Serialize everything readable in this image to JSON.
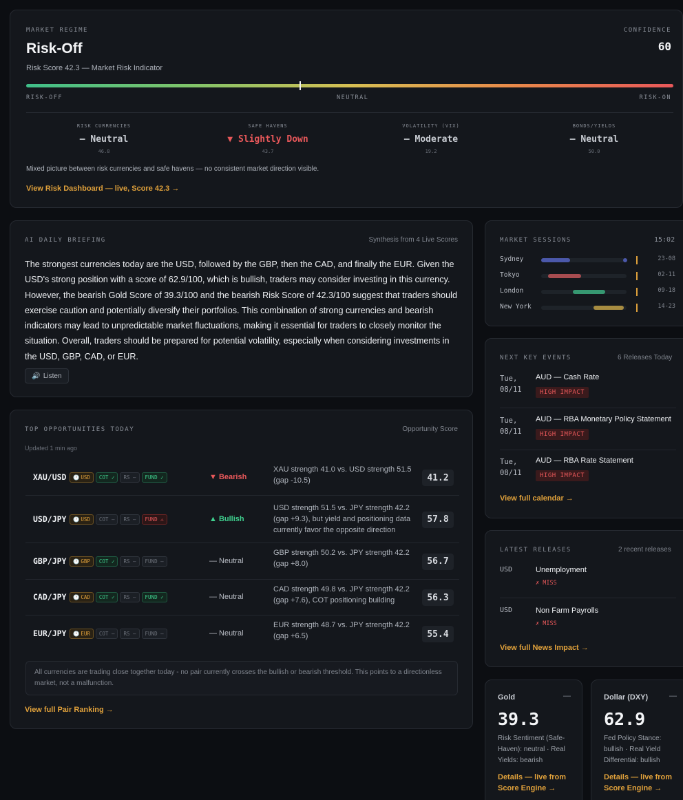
{
  "regime": {
    "label": "MARKET REGIME",
    "title": "Risk-Off",
    "subtitle": "Risk Score 42.3 — Market Risk Indicator",
    "confidence_label": "CONFIDENCE",
    "confidence_value": "60",
    "scale_left": "RISK-OFF",
    "scale_mid": "NEUTRAL",
    "scale_right": "RISK-ON",
    "score": 42.3,
    "indicators": [
      {
        "title": "RISK CURRENCIES",
        "value": "— Neutral",
        "num": "46.8"
      },
      {
        "title": "SAFE HAVENS",
        "value": "▼ Slightly Down",
        "num": "43.7"
      },
      {
        "title": "VOLATILITY (VIX)",
        "value": "— Moderate",
        "num": "19.2"
      },
      {
        "title": "BONDS/YIELDS",
        "value": "— Neutral",
        "num": "50.0"
      }
    ],
    "summary": "Mixed picture between risk currencies and safe havens — no consistent market direction visible.",
    "link": "View Risk Dashboard — live, Score 42.3 →"
  },
  "briefing": {
    "label": "AI DAILY BRIEFING",
    "meta": "Synthesis from 4 Live Scores",
    "text": "The strongest currencies today are the USD, followed by the GBP, then the CAD, and finally the EUR. Given the USD's strong position with a score of 62.9/100, which is bullish, traders may consider investing in this currency. However, the bearish Gold Score of 39.3/100 and the bearish Risk Score of 42.3/100 suggest that traders should exercise caution and potentially diversify their portfolios. This combination of strong currencies and bearish indicators may lead to unpredictable market fluctuations, making it essential for traders to closely monitor the situation. Overall, traders should be prepared for potential volatility, especially when considering investments in the USD, GBP, CAD, or EUR.",
    "listen": "Listen"
  },
  "opps": {
    "label": "TOP OPPORTUNITIES TODAY",
    "meta": "Opportunity Score",
    "updated": "Updated 1 min ago",
    "rows": [
      {
        "pair": "XAU/USD",
        "cur": "USD",
        "cot": "COT ✓",
        "rs": "RS –",
        "fund": "FUND ✓",
        "dir": "▼ Bearish",
        "desc": "XAU strength 41.0 vs. USD strength 51.5 (gap -10.5)",
        "score": "41.2"
      },
      {
        "pair": "USD/JPY",
        "cur": "USD",
        "cot": "COT –",
        "rs": "RS –",
        "fund": "FUND ⚠",
        "dir": "▲ Bullish",
        "desc": "USD strength 51.5 vs. JPY strength 42.2 (gap +9.3), but yield and positioning data currently favor the opposite direction",
        "score": "57.8"
      },
      {
        "pair": "GBP/JPY",
        "cur": "GBP",
        "cot": "COT ✓",
        "rs": "RS –",
        "fund": "FUND –",
        "dir": "— Neutral",
        "desc": "GBP strength 50.2 vs. JPY strength 42.2 (gap +8.0)",
        "score": "56.7"
      },
      {
        "pair": "CAD/JPY",
        "cur": "CAD",
        "cot": "COT ✓",
        "rs": "RS –",
        "fund": "FUND ✓",
        "dir": "— Neutral",
        "desc": "CAD strength 49.8 vs. JPY strength 42.2 (gap +7.6), COT positioning building",
        "score": "56.3"
      },
      {
        "pair": "EUR/JPY",
        "cur": "EUR",
        "cot": "COT –",
        "rs": "RS –",
        "fund": "FUND –",
        "dir": "— Neutral",
        "desc": "EUR strength 48.7 vs. JPY strength 42.2 (gap +6.5)",
        "score": "55.4"
      }
    ],
    "note": "All currencies are trading close together today - no pair currently crosses the bullish or bearish threshold. This points to a directionless market, not a malfunction.",
    "link": "View full Pair Ranking →"
  },
  "sessions": {
    "label": "MARKET SESSIONS",
    "time": "15:02",
    "rows": [
      {
        "name": "Sydney",
        "hours": "23-08",
        "color": "#5b6bd6"
      },
      {
        "name": "Tokyo",
        "hours": "02-11",
        "color": "#d65b5e"
      },
      {
        "name": "London",
        "hours": "09-18",
        "color": "#3fbf8a"
      },
      {
        "name": "New York",
        "hours": "14-23",
        "color": "#d6b04a"
      }
    ]
  },
  "events": {
    "label": "NEXT KEY EVENTS",
    "meta": "6 Releases Today",
    "items": [
      {
        "date": "Tue, 08/11",
        "title": "AUD — Cash Rate",
        "impact": "HIGH IMPACT"
      },
      {
        "date": "Tue, 08/11",
        "title": "AUD — RBA Monetary Policy Statement",
        "impact": "HIGH IMPACT"
      },
      {
        "date": "Tue, 08/11",
        "title": "AUD — RBA Rate Statement",
        "impact": "HIGH IMPACT"
      }
    ],
    "link": "View full calendar →"
  },
  "releases": {
    "label": "LATEST RELEASES",
    "meta": "2 recent releases",
    "items": [
      {
        "cur": "USD",
        "title": "Unemployment",
        "result": "✗ MISS"
      },
      {
        "cur": "USD",
        "title": "Non Farm Payrolls",
        "result": "✗ MISS"
      }
    ],
    "link": "View full News Impact →"
  },
  "gold": {
    "title": "Gold",
    "dash": "—",
    "value": "39.3",
    "sub": "Risk Sentiment (Safe-Haven): neutral · Real Yields: bearish",
    "link": "Details — live from Score Engine →"
  },
  "dollar": {
    "title": "Dollar (DXY)",
    "dash": "—",
    "value": "62.9",
    "sub": "Fed Policy Stance: bullish · Real Yield Differential: bullish",
    "link": "Details — live from Score Engine →"
  }
}
